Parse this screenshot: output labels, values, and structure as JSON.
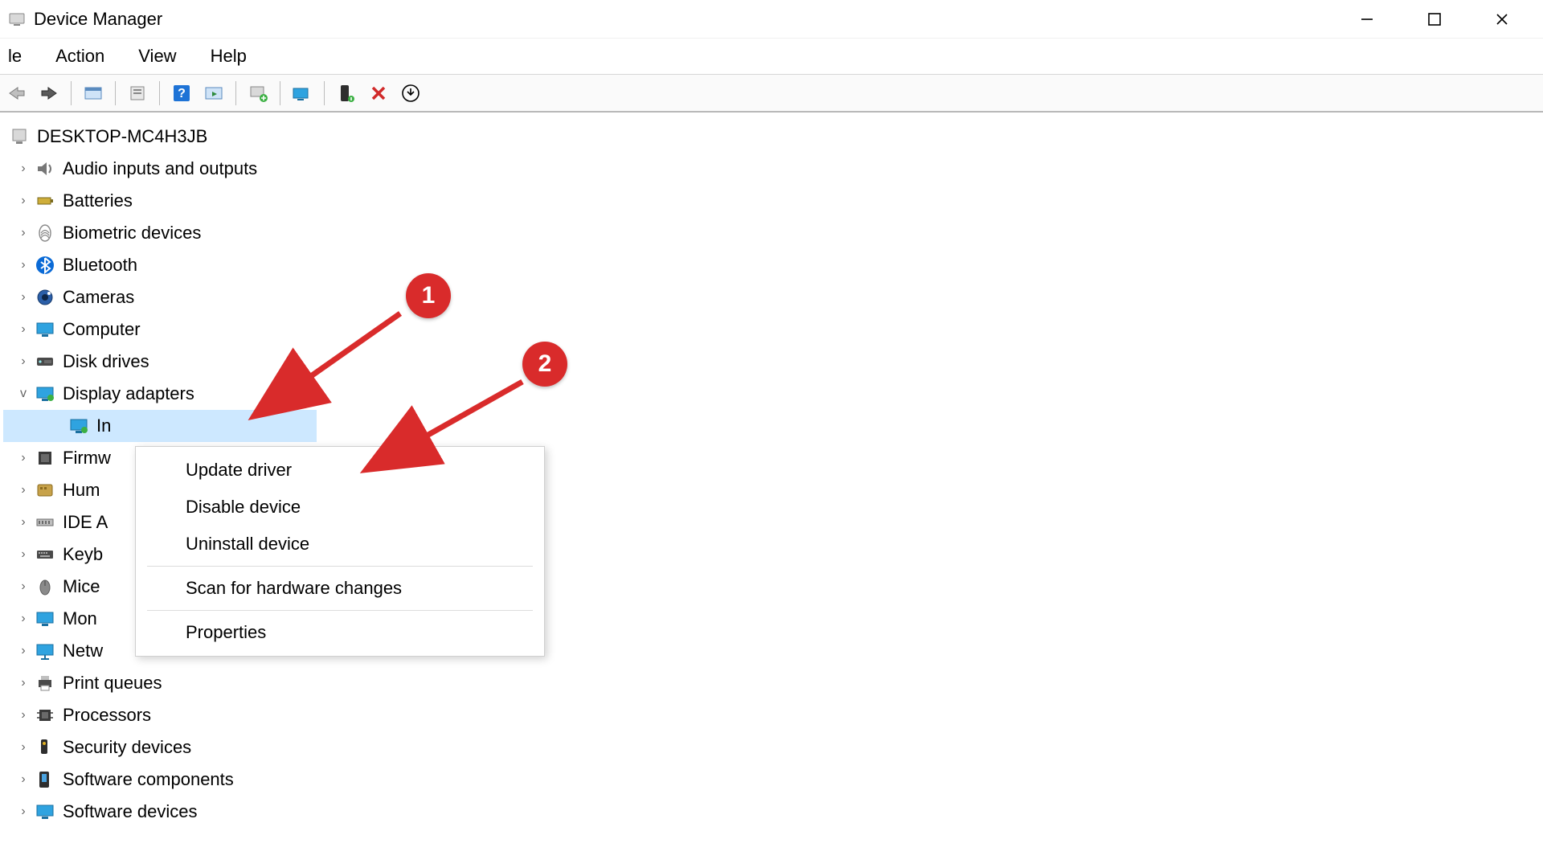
{
  "titlebar": {
    "title": "Device Manager"
  },
  "menubar": {
    "items": [
      "le",
      "Action",
      "View",
      "Help"
    ]
  },
  "tree": {
    "root": "DESKTOP-MC4H3JB",
    "categories": [
      {
        "label": "Audio inputs and outputs",
        "icon": "audio",
        "expanded": false
      },
      {
        "label": "Batteries",
        "icon": "battery",
        "expanded": false
      },
      {
        "label": "Biometric devices",
        "icon": "biometric",
        "expanded": false
      },
      {
        "label": "Bluetooth",
        "icon": "bluetooth",
        "expanded": false
      },
      {
        "label": "Cameras",
        "icon": "camera",
        "expanded": false
      },
      {
        "label": "Computer",
        "icon": "computer",
        "expanded": false
      },
      {
        "label": "Disk drives",
        "icon": "disk",
        "expanded": false
      },
      {
        "label": "Display adapters",
        "icon": "display",
        "expanded": true,
        "children": [
          {
            "label": "In",
            "icon": "display",
            "selected": true
          }
        ]
      },
      {
        "label": "Firmw",
        "icon": "firmware",
        "expanded": false
      },
      {
        "label": "Hum",
        "icon": "hid",
        "expanded": false
      },
      {
        "label": "IDE A",
        "icon": "ide",
        "expanded": false
      },
      {
        "label": "Keyb",
        "icon": "keyboard",
        "expanded": false
      },
      {
        "label": "Mice",
        "icon": "mouse",
        "expanded": false
      },
      {
        "label": "Mon",
        "icon": "monitor",
        "expanded": false
      },
      {
        "label": "Netw",
        "icon": "network",
        "expanded": false
      },
      {
        "label": "Print queues",
        "icon": "printer",
        "expanded": false
      },
      {
        "label": "Processors",
        "icon": "cpu",
        "expanded": false
      },
      {
        "label": "Security devices",
        "icon": "security",
        "expanded": false
      },
      {
        "label": "Software components",
        "icon": "swcomp",
        "expanded": false
      },
      {
        "label": "Software devices",
        "icon": "swdev",
        "expanded": false
      }
    ]
  },
  "context_menu": {
    "items": [
      {
        "label": "Update driver"
      },
      {
        "label": "Disable device"
      },
      {
        "label": "Uninstall device"
      },
      {
        "sep": true
      },
      {
        "label": "Scan for hardware changes"
      },
      {
        "sep": true
      },
      {
        "label": "Properties"
      }
    ]
  },
  "annotations": {
    "badge1": "1",
    "badge2": "2"
  }
}
